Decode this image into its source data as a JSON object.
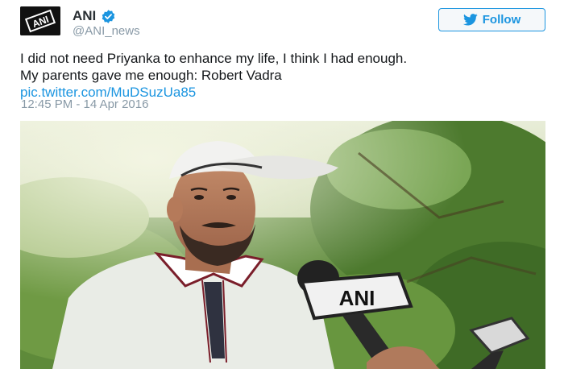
{
  "account": {
    "display_name": "ANI",
    "handle": "@ANI_news",
    "avatar_label": "ANI",
    "verified_icon": "verified-badge-icon"
  },
  "follow_button": {
    "label": "Follow",
    "icon": "twitter-bird-icon"
  },
  "tweet": {
    "line1": "I did not need Priyanka to enhance my life, I think I had enough.",
    "line2": "My parents gave me enough: Robert Vadra",
    "link": "pic.twitter.com/MuDSuzUa85",
    "timestamp": "12:45 PM - 14 Apr 2016"
  },
  "media": {
    "mic_logo_text": "ANI"
  },
  "colors": {
    "accent": "#1b95e0",
    "text": "#14171a",
    "muted": "#8899a6"
  }
}
